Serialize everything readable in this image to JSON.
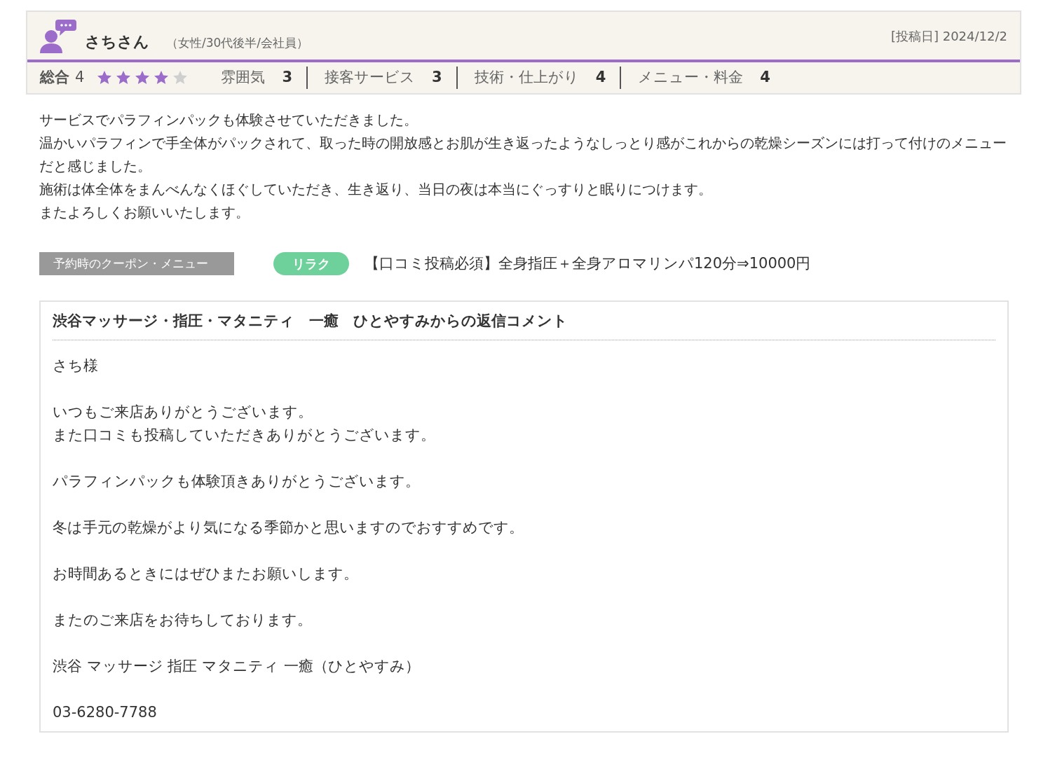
{
  "review": {
    "reviewer": "さちさん",
    "profile": "（女性/30代後半/会社員）",
    "posted": "[投稿日] 2024/12/2",
    "overall": {
      "label": "総合",
      "value": "4",
      "stars": 4
    },
    "ratings": [
      {
        "label": "雰囲気",
        "value": "3"
      },
      {
        "label": "接客サービス",
        "value": "3"
      },
      {
        "label": "技術・仕上がり",
        "value": "4"
      },
      {
        "label": "メニュー・料金",
        "value": "4"
      }
    ],
    "body": [
      "サービスでパラフィンパックも体験させていただきました。",
      "温かいパラフィンで手全体がパックされて、取った時の開放感とお肌が生き返ったようなしっとり感がこれからの乾燥シーズンには打って付けのメニューだと感じました。",
      "施術は体全体をまんべんなくほぐしていただき、生き返り、当日の夜は本当にぐっすりと眠りにつけます。",
      "またよろしくお願いいたします。"
    ],
    "coupon": {
      "label": "予約時のクーポン・メニュー",
      "tag": "リラク",
      "name": "【口コミ投稿必須】全身指圧＋全身アロマリンパ120分⇒10000円"
    }
  },
  "reply": {
    "title": "渋谷マッサージ・指圧・マタニティ　一癒　ひとやすみからの返信コメント",
    "paragraphs": [
      [
        "さち様"
      ],
      [
        "いつもご来店ありがとうございます。",
        "また口コミも投稿していただきありがとうございます。"
      ],
      [
        "パラフィンパックも体験頂きありがとうございます。"
      ],
      [
        "冬は手元の乾燥がより気になる季節かと思いますのでおすすめです。"
      ],
      [
        "お時間あるときにはぜひまたお願いします。"
      ],
      [
        "またのご来店をお待ちしております。"
      ],
      [
        "渋谷 マッサージ 指圧 マタニティ 一癒（ひとやすみ）"
      ],
      [
        "03-6280-7788"
      ]
    ]
  }
}
